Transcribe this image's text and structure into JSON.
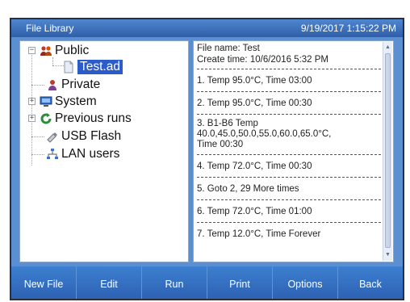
{
  "window": {
    "title": "File Library",
    "datetime": "9/19/2017 1:15:22 PM"
  },
  "tree": {
    "items": [
      {
        "label": "Public",
        "icon": "users-icon",
        "expander": "minus"
      },
      {
        "label": "Test.ad",
        "icon": "document-icon",
        "selected": true
      },
      {
        "label": "Private",
        "icon": "user-icon"
      },
      {
        "label": "System",
        "icon": "computer-icon",
        "expander": "plus"
      },
      {
        "label": "Previous runs",
        "icon": "refresh-icon",
        "expander": "plus"
      },
      {
        "label": "USB Flash",
        "icon": "usb-icon"
      },
      {
        "label": "LAN users",
        "icon": "network-icon"
      }
    ]
  },
  "details": {
    "file_name": "File name: Test",
    "create_time": "Create time: 10/6/2016 5:32 PM",
    "steps": [
      {
        "line1": "1. Temp 95.0°C, Time 03:00"
      },
      {
        "line1": "2. Temp 95.0°C, Time 00:30"
      },
      {
        "line1": "3. B1-B6 Temp",
        "line2": "40.0,45.0,50.0,55.0,60.0,65.0°C,",
        "line3": "Time 00:30"
      },
      {
        "line1": "4. Temp 72.0°C, Time 00:30"
      },
      {
        "line1": "5. Goto 2, 29 More times"
      },
      {
        "line1": "6. Temp 72.0°C, Time 01:00"
      },
      {
        "line1": "7. Temp 12.0°C, Time Forever"
      }
    ]
  },
  "softkeys": [
    "New File",
    "Edit",
    "Run",
    "Print",
    "Options",
    "Back"
  ],
  "colors": {
    "title_bar": "#3f74bf",
    "panel_background": "#5b8fd1",
    "selection": "#2b5cc9",
    "softkey_bar": "#2d5fb0"
  }
}
